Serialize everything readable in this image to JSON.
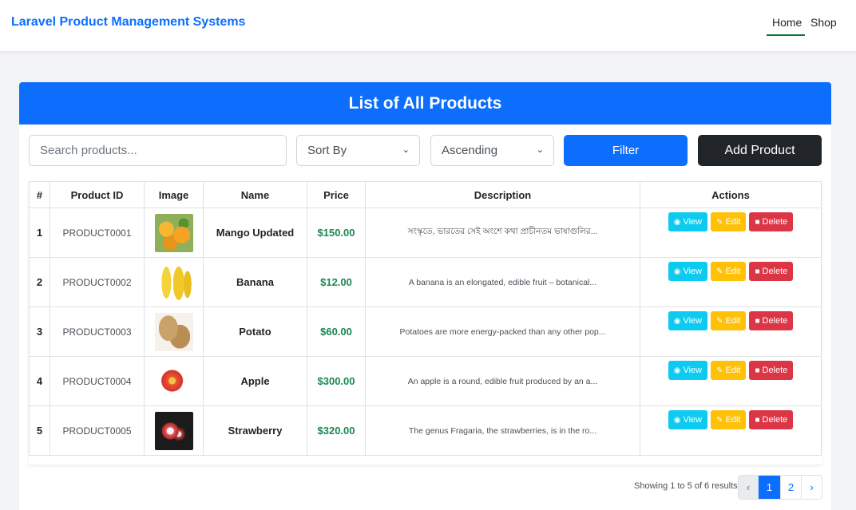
{
  "navbar": {
    "brand": "Laravel Product Management Systems",
    "links": [
      {
        "label": "Home",
        "active": true
      },
      {
        "label": "Shop",
        "active": false
      }
    ]
  },
  "card": {
    "title": "List of All Products"
  },
  "controls": {
    "search_placeholder": "Search products...",
    "sort_by": "Sort By",
    "order": "Ascending",
    "filter_label": "Filter",
    "add_label": "Add Product"
  },
  "table": {
    "headers": [
      "#",
      "Product ID",
      "Image",
      "Name",
      "Price",
      "Description",
      "Actions"
    ],
    "rows": [
      {
        "num": "1",
        "id": "PRODUCT0001",
        "image": "mango",
        "name": "Mango Updated",
        "price": "$150.00",
        "description": "সংস্কৃতে, ভারতের সেই অংশে কথা প্রাচীনতম ভাষাগুলির..."
      },
      {
        "num": "2",
        "id": "PRODUCT0002",
        "image": "banana",
        "name": "Banana",
        "price": "$12.00",
        "description": "A banana is an elongated, edible fruit – botanical..."
      },
      {
        "num": "3",
        "id": "PRODUCT0003",
        "image": "potato",
        "name": "Potato",
        "price": "$60.00",
        "description": "Potatoes are more energy-packed than any other pop..."
      },
      {
        "num": "4",
        "id": "PRODUCT0004",
        "image": "apple",
        "name": "Apple",
        "price": "$300.00",
        "description": "An apple is a round, edible fruit produced by an a..."
      },
      {
        "num": "5",
        "id": "PRODUCT0005",
        "image": "strawberry",
        "name": "Strawberry",
        "price": "$320.00",
        "description": "The genus Fragaria, the strawberries, is in the ro..."
      }
    ],
    "action_labels": {
      "view": "View",
      "edit": "Edit",
      "delete": "Delete"
    }
  },
  "pagination": {
    "summary": "Showing 1 to 5 of 6 results",
    "prev": "‹",
    "pages": [
      "1",
      "2"
    ],
    "current": "1",
    "next": "›"
  },
  "colors": {
    "primary": "#0d6efd",
    "dark": "#212529",
    "price": "#198754",
    "view": "#0dcaf0",
    "edit": "#ffc107",
    "delete": "#dc3545"
  }
}
